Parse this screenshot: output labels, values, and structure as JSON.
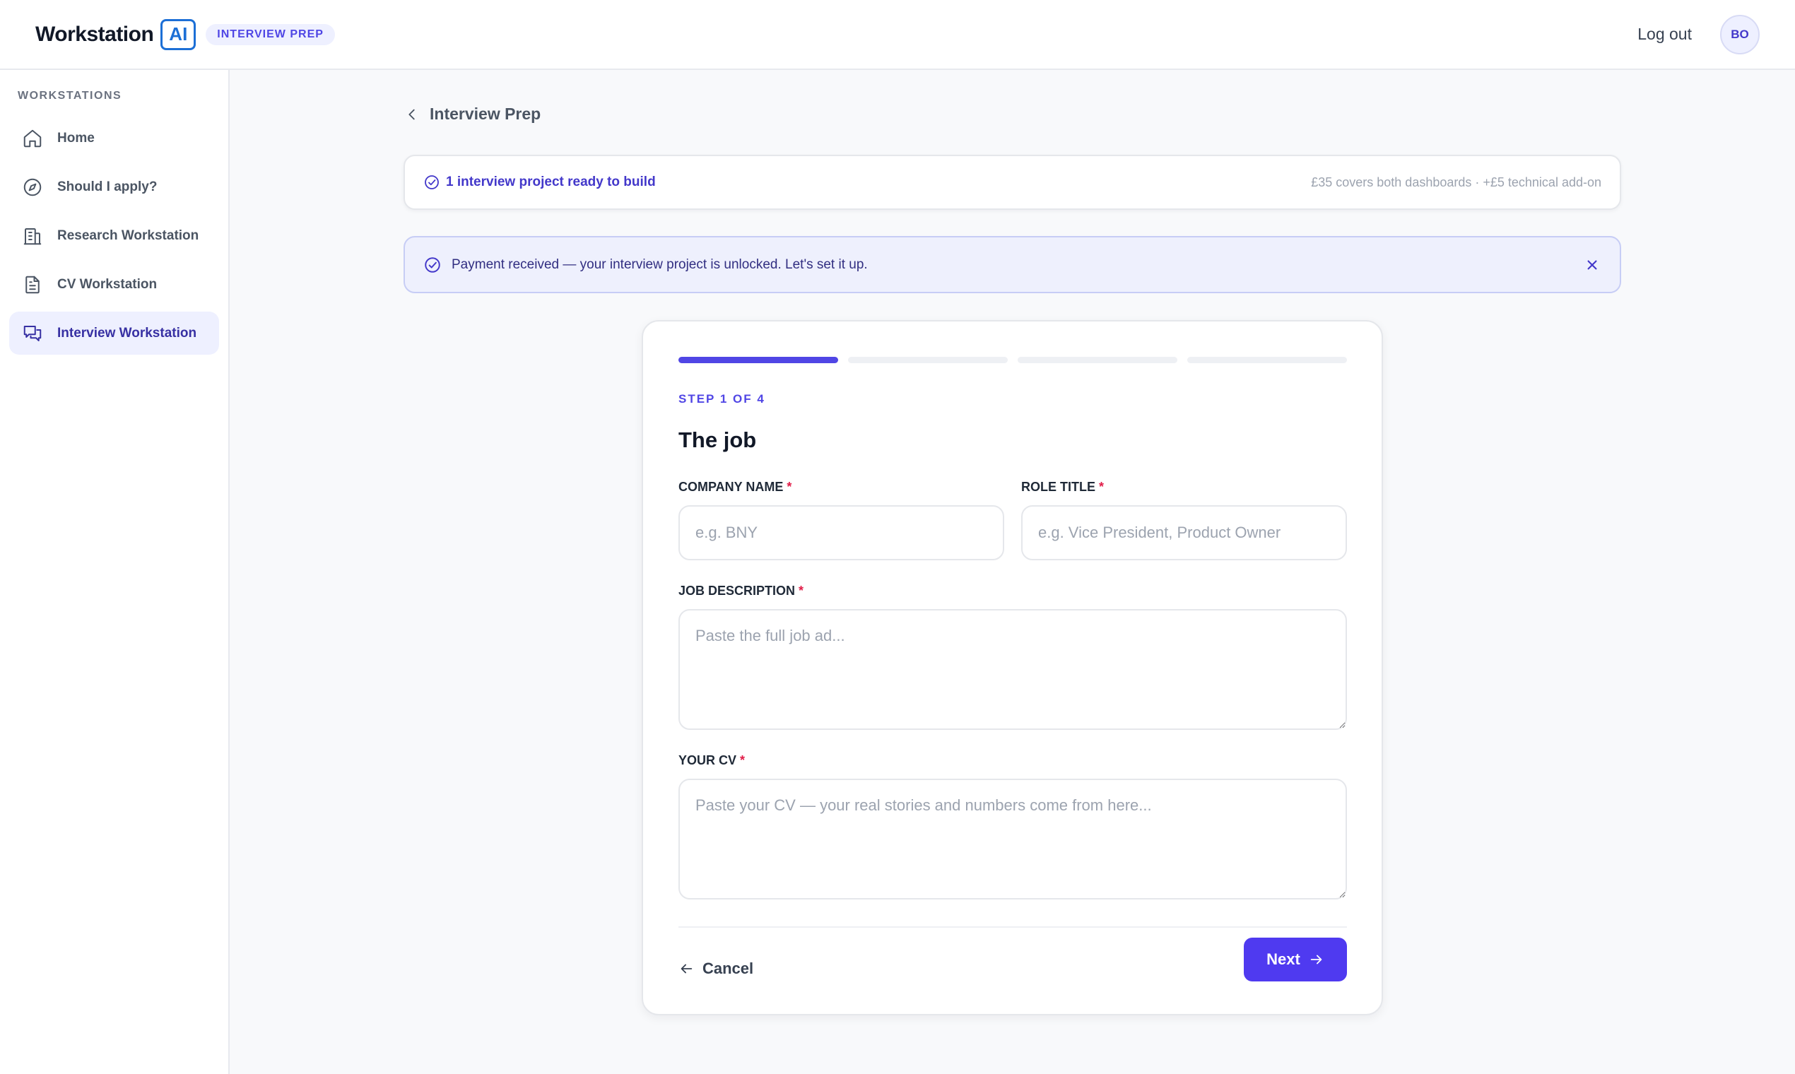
{
  "header": {
    "brand_word": "Workstation",
    "brand_ai": "AI",
    "badge": "INTERVIEW PREP",
    "logout_label": "Log out",
    "avatar_initials": "BO"
  },
  "sidebar": {
    "heading": "WORKSTATIONS",
    "items": [
      {
        "label": "Home",
        "icon": "home-icon",
        "active": false
      },
      {
        "label": "Should I apply?",
        "icon": "compass-icon",
        "active": false
      },
      {
        "label": "Research Workstation",
        "icon": "building-icon",
        "active": false
      },
      {
        "label": "CV Workstation",
        "icon": "document-icon",
        "active": false
      },
      {
        "label": "Interview Workstation",
        "icon": "chat-icon",
        "active": true
      }
    ]
  },
  "main": {
    "back_label": "Interview Prep",
    "project_bar": {
      "status": "1 interview project ready to build",
      "pricing": "£35 covers both dashboards · +£5 technical add-on"
    },
    "alert": {
      "message": "Payment received — your interview project is unlocked. Let's set it up."
    },
    "wizard": {
      "total_steps": 4,
      "current_step": 1,
      "step_label": "STEP 1 OF 4",
      "title": "The job",
      "fields": {
        "company": {
          "label": "COMPANY NAME",
          "required_mark": "*",
          "placeholder": "e.g. BNY",
          "value": ""
        },
        "role": {
          "label": "ROLE TITLE",
          "required_mark": "*",
          "placeholder": "e.g. Vice President, Product Owner",
          "value": ""
        },
        "job_description": {
          "label": "JOB DESCRIPTION",
          "required_mark": "*",
          "placeholder": "Paste the full job ad...",
          "value": ""
        },
        "cv": {
          "label": "YOUR CV",
          "required_mark": "*",
          "placeholder": "Paste your CV — your real stories and numbers come from here...",
          "value": ""
        }
      },
      "cancel_label": "Cancel",
      "next_label": "Next"
    }
  },
  "colors": {
    "accent": "#4f3af0",
    "brand_blue": "#1c6fd6",
    "required": "#e11d48"
  }
}
